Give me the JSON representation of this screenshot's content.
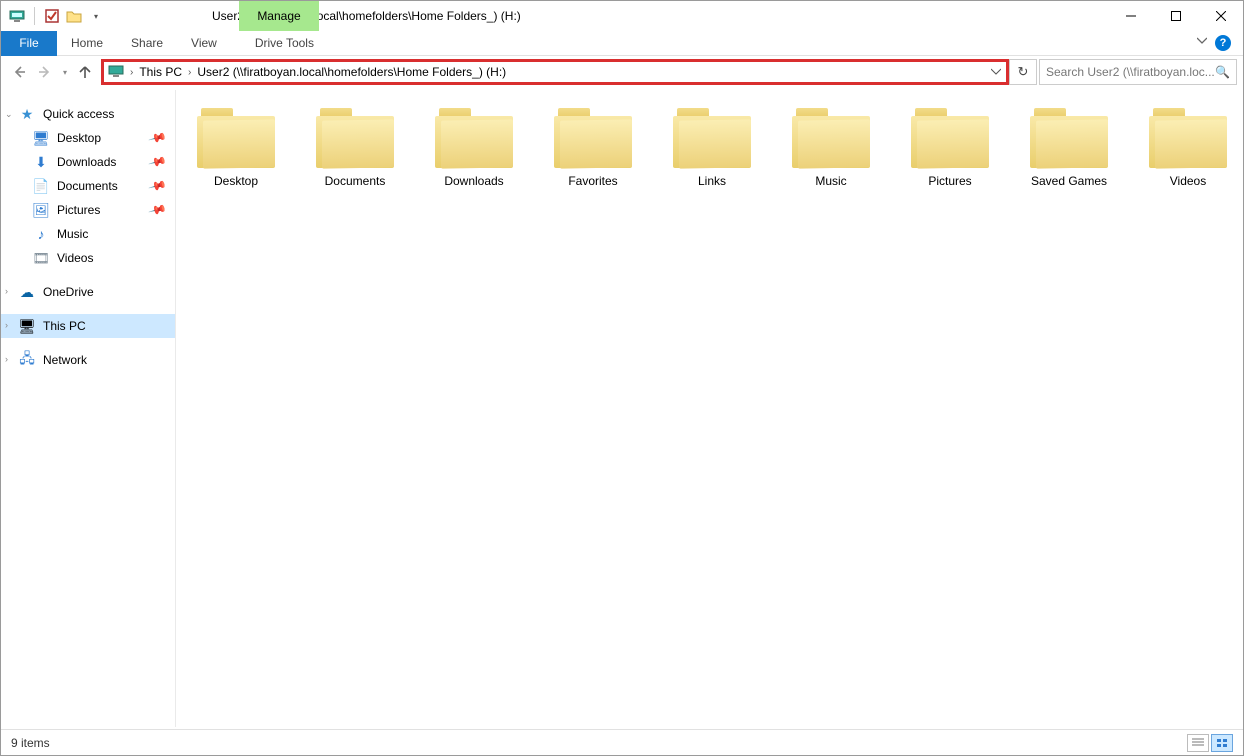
{
  "titlebar": {
    "contextual_tab": "Manage",
    "title": "User2 (\\\\firatboyan.local\\homefolders\\Home Folders_) (H:)"
  },
  "ribbon": {
    "file": "File",
    "tabs": [
      "Home",
      "Share",
      "View"
    ],
    "contextual": "Drive Tools"
  },
  "address": {
    "crumbs": [
      "This PC",
      "User2 (\\\\firatboyan.local\\homefolders\\Home Folders_) (H:)"
    ]
  },
  "search": {
    "placeholder": "Search User2 (\\\\firatboyan.loc..."
  },
  "sidebar": {
    "quick_access": "Quick access",
    "items": [
      {
        "label": "Desktop",
        "pinned": true
      },
      {
        "label": "Downloads",
        "pinned": true
      },
      {
        "label": "Documents",
        "pinned": true
      },
      {
        "label": "Pictures",
        "pinned": true
      },
      {
        "label": "Music",
        "pinned": false
      },
      {
        "label": "Videos",
        "pinned": false
      }
    ],
    "onedrive": "OneDrive",
    "thispc": "This PC",
    "network": "Network"
  },
  "folders": [
    "Desktop",
    "Documents",
    "Downloads",
    "Favorites",
    "Links",
    "Music",
    "Pictures",
    "Saved Games",
    "Videos"
  ],
  "statusbar": {
    "count": "9 items"
  }
}
